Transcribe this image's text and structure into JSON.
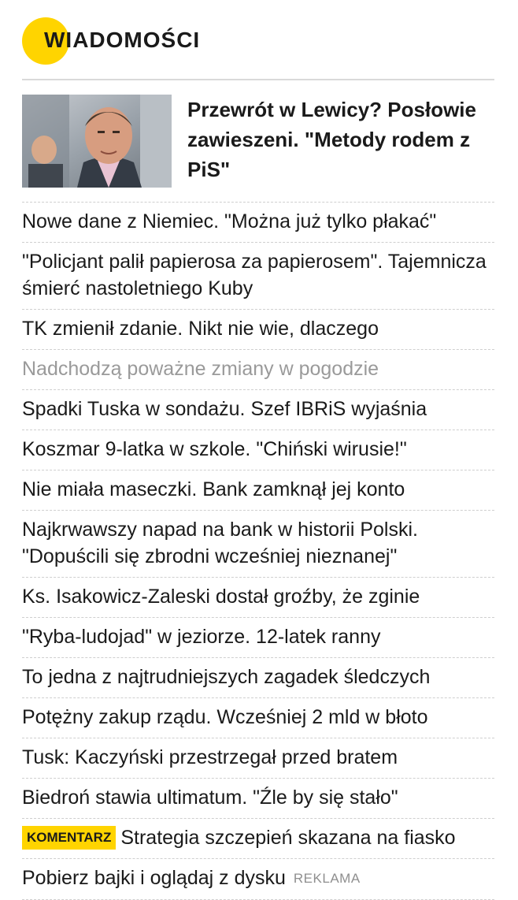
{
  "section": {
    "title": "WIADOMOŚCI",
    "accent_color": "#ffd400"
  },
  "lead": {
    "image_icon": "news-photo-man",
    "title": "Przewrót w Lewicy? Posłowie zawieszeni. \"Metody rodem z PiS\""
  },
  "items": [
    {
      "text": "Nowe dane z Niemiec. \"Można już tylko płakać\""
    },
    {
      "text": "\"Policjant palił papierosa za papierosem\". Tajemnicza śmierć nastoletniego Kuby"
    },
    {
      "text": "TK zmienił zdanie. Nikt nie wie, dlaczego"
    },
    {
      "text": "Nadchodzą poważne zmiany w pogodzie",
      "muted": true
    },
    {
      "text": "Spadki Tuska w sondażu. Szef IBRiS wyjaśnia"
    },
    {
      "text": "Koszmar 9-latka w szkole. \"Chiński wirusie!\""
    },
    {
      "text": "Nie miała maseczki. Bank zamknął jej konto"
    },
    {
      "text": "Najkrwawszy napad na bank w historii Polski. \"Dopuścili się zbrodni wcześniej nieznanej\""
    },
    {
      "text": "Ks. Isakowicz-Zaleski dostał groźby, że zginie"
    },
    {
      "text": "\"Ryba-ludojad\" w jeziorze. 12-latek ranny"
    },
    {
      "text": "To jedna z najtrudniejszych zagadek śledczych"
    },
    {
      "text": "Potężny zakup rządu. Wcześniej 2 mld w błoto"
    },
    {
      "text": "Tusk: Kaczyński przestrzegał przed bratem"
    },
    {
      "text": "Biedroń stawia ultimatum. \"Źle by się stało\""
    },
    {
      "text": "Strategia szczepień skazana na fiasko",
      "badge": "KOMENTARZ"
    },
    {
      "text": "Pobierz bajki i oglądaj z dysku",
      "ad": "REKLAMA"
    }
  ]
}
